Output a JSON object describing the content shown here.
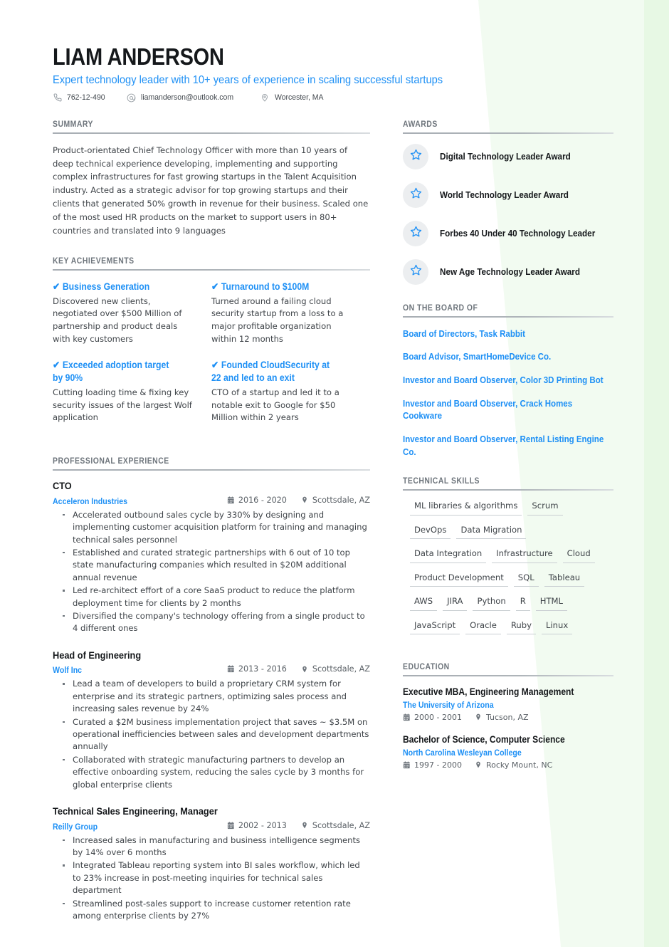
{
  "theme": {
    "accent_blue": "#1e90f5",
    "heading_gray": "#6e757c",
    "text_dark": "#15181b",
    "body_gray": "#3f4449",
    "bg_green": "#eefaee",
    "badge_bg": "#eceef0"
  },
  "header": {
    "name": "LIAM ANDERSON",
    "tagline": "Expert technology leader with 10+ years of experience in scaling successful startups",
    "contacts": [
      {
        "icon": "phone-icon",
        "text": "762-12-490"
      },
      {
        "icon": "email-icon",
        "text": "liamanderson@outlook.com"
      },
      {
        "icon": "location-pin-icon",
        "text": "Worcester, MA"
      }
    ]
  },
  "summary": {
    "title": "SUMMARY",
    "text": "Product-orientated Chief Technology Officer with more than 10 years of deep technical experience developing, implementing and supporting complex infrastructures for fast growing startups in the Talent Acquisition industry. Acted as a strategic advisor for top growing startups and their clients that generated 50% growth in revenue for their business. Scaled one of the most used HR products on the market to support users in 80+ countries and translated into 9 languages"
  },
  "key_achievements": {
    "title": "KEY ACHIEVEMENTS",
    "check_glyph": "✔",
    "items": [
      {
        "heading": "Business Generation",
        "description": "Discovered new clients, negotiated over $500 Million of partnership and product deals with key customers"
      },
      {
        "heading": "Turnaround to $100M",
        "description": "Turned around a failing cloud security startup from a loss to a major profitable organization within 12 months"
      },
      {
        "heading": "Exceeded adoption target by 90%",
        "description": "Cutting loading time & fixing key security issues of the largest Wolf application"
      },
      {
        "heading": "Founded CloudSecurity at 22 and led to an exit",
        "description": "CTO of a startup and led it to a notable exit to Google for $50 Million within 2 years"
      }
    ]
  },
  "experience": {
    "title": "PROFESSIONAL EXPERIENCE",
    "jobs": [
      {
        "title": "CTO",
        "company": "Acceleron Industries",
        "dates": "2016 - 2020",
        "location": "Scottsdale, AZ",
        "bullets": [
          "Accelerated outbound sales cycle by 330% by designing and implementing customer acquisition platform for training and managing technical sales personnel",
          "Established and curated strategic partnerships with 6 out of 10 top state manufacturing companies which resulted in $20M additional annual revenue",
          "Led re-architect effort of a core SaaS product to reduce the platform deployment time for clients by 2 months",
          "Diversified the company's technology offering from a single product to 4 different ones"
        ]
      },
      {
        "title": "Head of Engineering",
        "company": "Wolf Inc",
        "dates": "2013 - 2016",
        "location": "Scottsdale, AZ",
        "bullets": [
          "Lead a team of developers to build a proprietary CRM system for enterprise and its strategic partners, optimizing sales process and increasing sales revenue by 24%",
          "Curated a $2M business implementation project that saves ~ $3.5M on operational inefficiencies between sales and development departments annually",
          "Collaborated with strategic manufacturing partners to develop an effective onboarding system, reducing the sales cycle by 3 months for global enterprise clients"
        ]
      },
      {
        "title": "Technical Sales Engineering, Manager",
        "company": "Reilly Group",
        "dates": "2002 - 2013",
        "location": "Scottsdale, AZ",
        "bullets": [
          "Increased sales in manufacturing and business intelligence segments by 14% over 6 months",
          "Integrated Tableau reporting system into BI sales workflow, which led to 23% increase in post-meeting inquiries for technical sales department",
          "Streamlined post-sales support to increase customer retention rate among enterprise clients by 27%"
        ]
      }
    ]
  },
  "awards": {
    "title": "AWARDS",
    "items": [
      {
        "icon": "star-icon",
        "label": "Digital Technology Leader Award"
      },
      {
        "icon": "star-icon",
        "label": "World Technology Leader Award"
      },
      {
        "icon": "star-icon",
        "label": "Forbes 40 Under 40 Technology Leader"
      },
      {
        "icon": "star-icon",
        "label": "New Age Technology Leader Award"
      }
    ]
  },
  "board": {
    "title": "ON THE BOARD OF",
    "items": [
      "Board of Directors, Task Rabbit",
      "Board Advisor, SmartHomeDevice Co.",
      "Investor and Board Observer, Color 3D Printing Bot",
      "Investor and Board Observer, Crack Homes Cookware",
      "Investor and Board Observer, Rental Listing Engine Co."
    ]
  },
  "skills": {
    "title": "TECHNICAL SKILLS",
    "items": [
      "ML libraries & algorithms",
      "Scrum",
      "DevOps",
      "Data Migration",
      "Data Integration",
      "Infrastructure",
      "Cloud",
      "Product Development",
      "SQL",
      "Tableau",
      "AWS",
      "JIRA",
      "Python",
      "R",
      "HTML",
      "JavaScript",
      "Oracle",
      "Ruby",
      "Linux"
    ]
  },
  "education": {
    "title": "EDUCATION",
    "items": [
      {
        "degree": "Executive MBA, Engineering Management",
        "school": "The University of Arizona",
        "dates": "2000 - 2001",
        "location": "Tucson, AZ"
      },
      {
        "degree": "Bachelor of Science, Computer Science",
        "school": "North Carolina Wesleyan College",
        "dates": "1997 - 2000",
        "location": "Rocky Mount, NC"
      }
    ]
  }
}
